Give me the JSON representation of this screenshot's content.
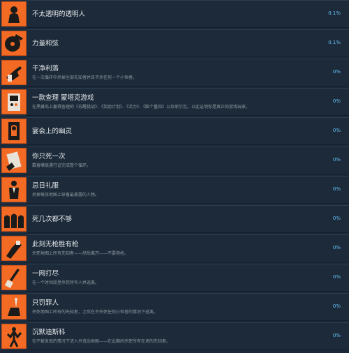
{
  "achievements": [
    {
      "title": "不太透明的透明人",
      "desc": "",
      "percent": "0.1%",
      "icon": "ghost-silhouette-icon"
    },
    {
      "title": "力量和弦",
      "desc": "",
      "percent": "0.1%",
      "icon": "vinyl-record-icon"
    },
    {
      "title": "干净利落",
      "desc": "在一次循环中杀掉全部先知者并且不杀任何一个小恒者。",
      "percent": "0%",
      "icon": "pointing-hand-icon"
    },
    {
      "title": "一款查理 蒙塔克游戏",
      "desc": "在黑藏岛上赢得查理的《苏醒挑战》、《奖励计划》、《活力》、《脑个量四》以及耶尔瓦。以此证明你是真正的游戏玩家。",
      "percent": "0%",
      "icon": "arcade-cabinet-icon"
    },
    {
      "title": "宴会上的幽灵",
      "desc": "",
      "percent": "0%",
      "icon": "hooded-figure-icon"
    },
    {
      "title": "你只死一次",
      "desc": "戴着嘴很遇行证完成整个循环。",
      "percent": "0%",
      "icon": "hand-card-icon"
    },
    {
      "title": "忌日礼服",
      "desc": "杀掉每张地图上穿着最暴露的人物。",
      "percent": "0%",
      "icon": "tuxedo-figure-icon"
    },
    {
      "title": "死几次都不够",
      "desc": "",
      "percent": "0%",
      "icon": "tombstones-icon"
    },
    {
      "title": "此刻无枪胜有枪",
      "desc": "杀死地图上所有先知者——然后离开——不要用枪。",
      "percent": "0%",
      "icon": "fist-icon"
    },
    {
      "title": "一网打尽",
      "desc": "在一个时间段里杀死所有人并逃离。",
      "percent": "0%",
      "icon": "broom-icon"
    },
    {
      "title": "只罚罪人",
      "desc": "杀死地图上所有的先知者，之后在不杀死任何小恒者的情况下逃离。",
      "percent": "0%",
      "icon": "blade-hand-icon"
    },
    {
      "title": "沉默迪斯科",
      "desc": "在不被发现的情况下进入并逃出地图——在此期间杀死所有在场的先知者。",
      "percent": "0%",
      "icon": "dancer-icon"
    }
  ]
}
